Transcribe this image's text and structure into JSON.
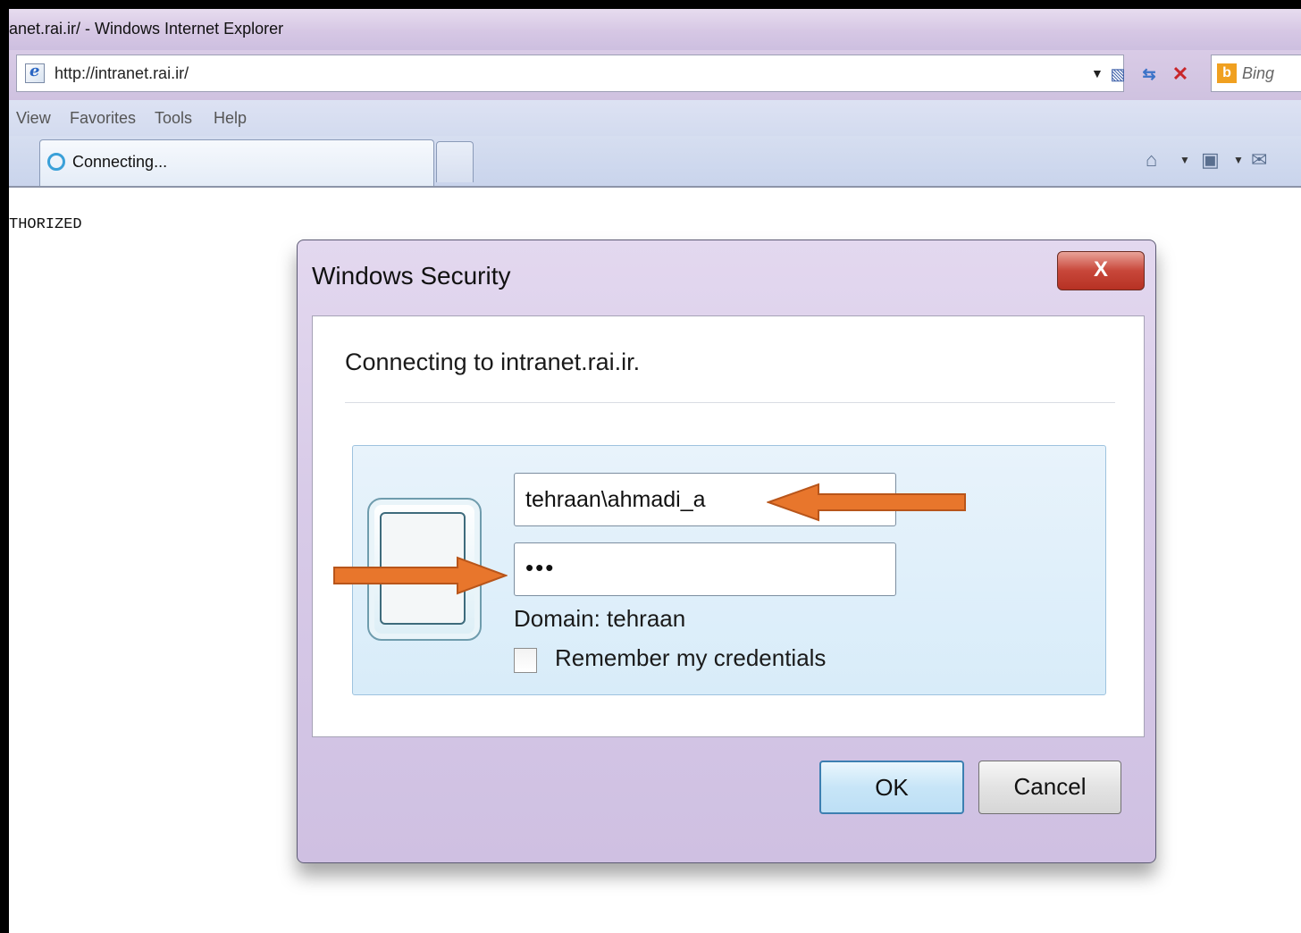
{
  "window": {
    "title": "anet.rai.ir/ - Windows Internet Explorer"
  },
  "address_bar": {
    "url": "http://intranet.rai.ir/",
    "search_placeholder": "Bing"
  },
  "menu": {
    "items": [
      "View",
      "Favorites",
      "Tools",
      "Help"
    ]
  },
  "tabs": {
    "active_label": "Connecting..."
  },
  "page": {
    "body_text": "THORIZED"
  },
  "dialog": {
    "title": "Windows Security",
    "close_label": "X",
    "message": "Connecting to intranet.rai.ir.",
    "username_value": "tehraan\\ahmadi_a",
    "password_value": "•••",
    "domain_text": "Domain: tehraan",
    "remember_label": "Remember my credentials",
    "ok_label": "OK",
    "cancel_label": "Cancel"
  },
  "icons": {
    "ie_page": "ie-page-icon",
    "compat": "compatibility-view-icon",
    "refresh": "refresh-icon",
    "stop": "stop-icon",
    "bing": "bing-icon",
    "loading": "loading-spinner-icon",
    "home": "home-icon",
    "feeds": "rss-feed-icon",
    "mail": "mail-icon",
    "annotation_arrow": "orange-arrow-icon"
  },
  "colors": {
    "annotation_arrow": "#e8762c",
    "close_button": "#c8473a",
    "ok_border": "#3c7fb1"
  }
}
